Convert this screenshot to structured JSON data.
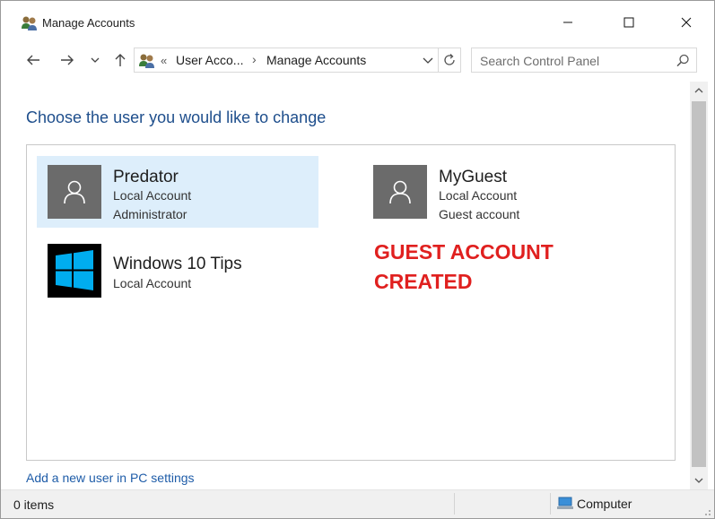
{
  "window": {
    "title": "Manage Accounts"
  },
  "nav": {
    "breadcrumb_sep": "«",
    "crumb1": "User Acco...",
    "crumb_arrow": "›",
    "crumb2": "Manage Accounts",
    "search_placeholder": "Search Control Panel"
  },
  "content": {
    "heading": "Choose the user you would like to change",
    "accounts": [
      {
        "name": "Predator",
        "line1": "Local Account",
        "line2": "Administrator",
        "selected": true
      },
      {
        "name": "MyGuest",
        "line1": "Local Account",
        "line2": "Guest account",
        "selected": false
      },
      {
        "name": "Windows 10 Tips",
        "line1": "Local Account",
        "selected": false
      }
    ],
    "annotation_line1": "GUEST ACCOUNT",
    "annotation_line2": "CREATED",
    "add_user_link": "Add a new user in PC settings"
  },
  "status": {
    "items": "0 items",
    "location": "Computer"
  },
  "colors": {
    "accent_blue": "#1e4e8c",
    "link_blue": "#1e5ca8",
    "selected_bg": "#ddeefb",
    "avatar_gray": "#6b6b6b",
    "annotation_red": "#e0201f",
    "windows_logo_blue": "#00adef"
  }
}
